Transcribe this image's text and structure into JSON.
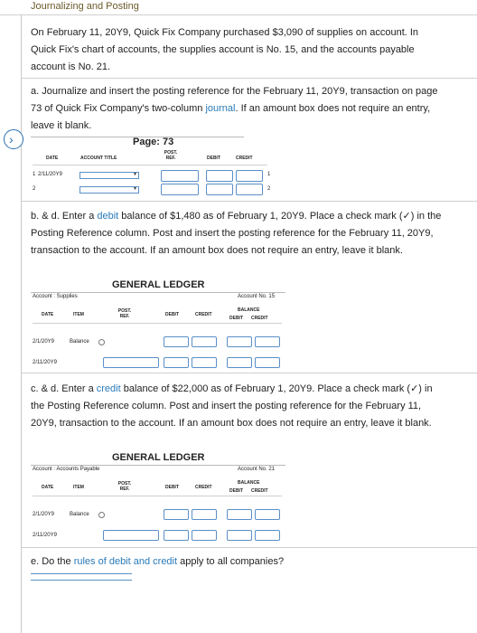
{
  "header": {
    "title": "Journalizing and Posting"
  },
  "intro": {
    "p1": "On February 11, 20Y9, Quick Fix Company purchased $3,090 of supplies on account. In Quick Fix's chart of accounts, the supplies account is No. 15, and the accounts payable account is No. 21."
  },
  "part_a": {
    "pre": "a. Journalize and insert the posting reference for the February 11, 20Y9, transaction on page 73 of Quick Fix Company's two-column ",
    "link": "journal",
    "post": ". If an amount box does not require an entry, leave it blank.",
    "page_label": "Page: 73",
    "columns": {
      "date": "DATE",
      "account": "ACCOUNT TITLE",
      "post": "POST. REF.",
      "debit": "DEBIT",
      "credit": "CREDIT"
    },
    "rows": [
      {
        "num": "1",
        "date": "2/11/20Y9",
        "right_num": "1"
      },
      {
        "num": "2",
        "date": "",
        "right_num": "2"
      }
    ]
  },
  "part_b": {
    "pre": "b. & d. Enter a ",
    "link": "debit",
    "post": " balance of $1,480 as of February 1, 20Y9. Place a check mark (✓) in the Posting Reference column. Post and insert the posting reference for the February 11, 20Y9, transaction to the account. If an amount box does not require an entry, leave it blank.",
    "ledger_title": "GENERAL LEDGER",
    "account_name": "Account : Supplies",
    "account_no": "Account No. 15",
    "columns": {
      "date": "DATE",
      "item": "ITEM",
      "post": "POST. REF.",
      "debit": "DEBIT",
      "credit": "CREDIT",
      "balance": "BALANCE",
      "bal_debit": "DEBIT",
      "bal_credit": "CREDIT"
    },
    "rows": [
      {
        "date": "2/1/20Y9",
        "item": "Balance"
      },
      {
        "date": "2/11/20Y9",
        "item": ""
      }
    ]
  },
  "part_c": {
    "pre": "c. & d. Enter a ",
    "link": "credit",
    "post": " balance of $22,000 as of February 1, 20Y9. Place a check mark (✓) in the Posting Reference column. Post and insert the posting reference for the February 11, 20Y9, transaction to the account. If an amount box does not require an entry, leave it blank.",
    "ledger_title": "GENERAL LEDGER",
    "account_name": "Account : Accounts Payable",
    "account_no": "Account No. 21",
    "columns": {
      "date": "DATE",
      "item": "ITEM",
      "post": "POST. REF.",
      "debit": "DEBIT",
      "credit": "CREDIT",
      "balance": "BALANCE",
      "bal_debit": "DEBIT",
      "bal_credit": "CREDIT"
    },
    "rows": [
      {
        "date": "2/1/20Y9",
        "item": "Balance"
      },
      {
        "date": "2/11/20Y9",
        "item": ""
      }
    ]
  },
  "part_e": {
    "pre": "e. Do the ",
    "link": "rules of debit and credit",
    "post": " apply to all companies?"
  }
}
